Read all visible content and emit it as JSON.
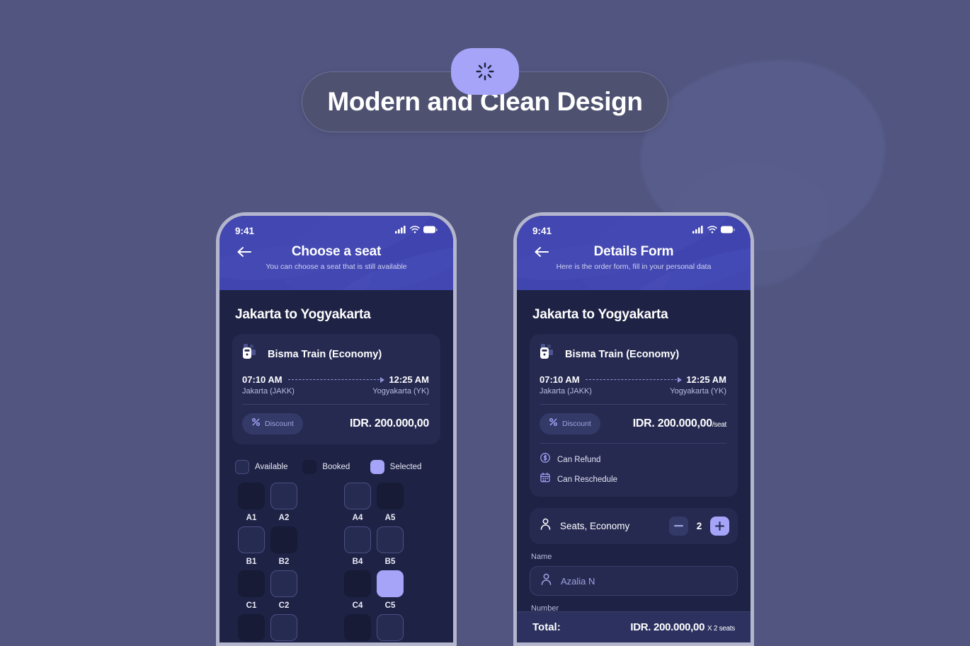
{
  "background_color": "#515580",
  "banner": {
    "title": "Modern and Clean Design",
    "badge_icon": "loading-spinner-icon",
    "accent_color": "#a5a4f8",
    "pill_color": "#4e5270"
  },
  "phones": [
    {
      "id": "choose-a-seat",
      "status_bar": {
        "time": "9:41",
        "icons": [
          "cellular-signal-icon",
          "wifi-icon",
          "battery-icon"
        ]
      },
      "header": {
        "back_icon": "arrow-left-icon",
        "title": "Choose a seat",
        "subtitle": "You can choose a seat that is still available",
        "color": "#3b3fa8"
      },
      "route_title": "Jakarta to Yogyakarta",
      "train_card": {
        "icon": "train-icon",
        "name": "Bisma Train (Economy)",
        "depart_time": "07:10 AM",
        "arrive_time": "12:25 AM",
        "depart_station": "Jakarta (JAKK)",
        "arrive_station": "Yogyakarta (YK)",
        "discount_icon": "percent-icon",
        "discount_label": "Discount",
        "price": "IDR. 200.000,00",
        "price_suffix": ""
      },
      "legend": [
        {
          "label": "Available",
          "state": "available"
        },
        {
          "label": "Booked",
          "state": "booked"
        },
        {
          "label": "Selected",
          "state": "selected"
        }
      ],
      "seat_rows": [
        {
          "seats": [
            {
              "label": "A1",
              "state": "booked"
            },
            {
              "label": "A2",
              "state": "available"
            },
            {
              "label": "",
              "state": "aisle"
            },
            {
              "label": "A4",
              "state": "available"
            },
            {
              "label": "A5",
              "state": "booked"
            }
          ]
        },
        {
          "seats": [
            {
              "label": "B1",
              "state": "available"
            },
            {
              "label": "B2",
              "state": "booked"
            },
            {
              "label": "",
              "state": "aisle"
            },
            {
              "label": "B4",
              "state": "available"
            },
            {
              "label": "B5",
              "state": "available"
            }
          ]
        },
        {
          "seats": [
            {
              "label": "C1",
              "state": "booked"
            },
            {
              "label": "C2",
              "state": "available"
            },
            {
              "label": "",
              "state": "aisle"
            },
            {
              "label": "C4",
              "state": "booked"
            },
            {
              "label": "C5",
              "state": "selected"
            }
          ]
        },
        {
          "seats": [
            {
              "label": "",
              "state": "booked"
            },
            {
              "label": "",
              "state": "available"
            },
            {
              "label": "",
              "state": "aisle"
            },
            {
              "label": "",
              "state": "booked"
            },
            {
              "label": "",
              "state": "available"
            }
          ]
        }
      ]
    },
    {
      "id": "details-form",
      "status_bar": {
        "time": "9:41",
        "icons": [
          "cellular-signal-icon",
          "wifi-icon",
          "battery-icon"
        ]
      },
      "header": {
        "back_icon": "arrow-left-icon",
        "title": "Details Form",
        "subtitle": "Here is the order form, fill in your personal data",
        "color": "#3b3fa8"
      },
      "route_title": "Jakarta to Yogyakarta",
      "train_card": {
        "icon": "train-icon",
        "name": "Bisma Train (Economy)",
        "depart_time": "07:10 AM",
        "arrive_time": "12:25 AM",
        "depart_station": "Jakarta (JAKK)",
        "arrive_station": "Yogyakarta (YK)",
        "discount_icon": "percent-icon",
        "discount_label": "Discount",
        "price": "IDR. 200.000,00",
        "price_suffix": "/seat"
      },
      "perks": [
        {
          "icon": "refund-dollar-icon",
          "label": "Can Refund"
        },
        {
          "icon": "calendar-icon",
          "label": "Can Reschedule"
        }
      ],
      "seats_stepper": {
        "icon": "person-icon",
        "label": "Seats, Economy",
        "minus_label": "−",
        "value": "2",
        "plus_label": "+"
      },
      "fields": [
        {
          "label": "Name",
          "icon": "person-icon",
          "value": "Azalia N"
        },
        {
          "label": "Number",
          "icon": "person-icon",
          "value": ""
        }
      ],
      "total": {
        "label": "Total:",
        "amount": "IDR. 200.000,00",
        "multiplier": "X 2 seats"
      }
    }
  ]
}
